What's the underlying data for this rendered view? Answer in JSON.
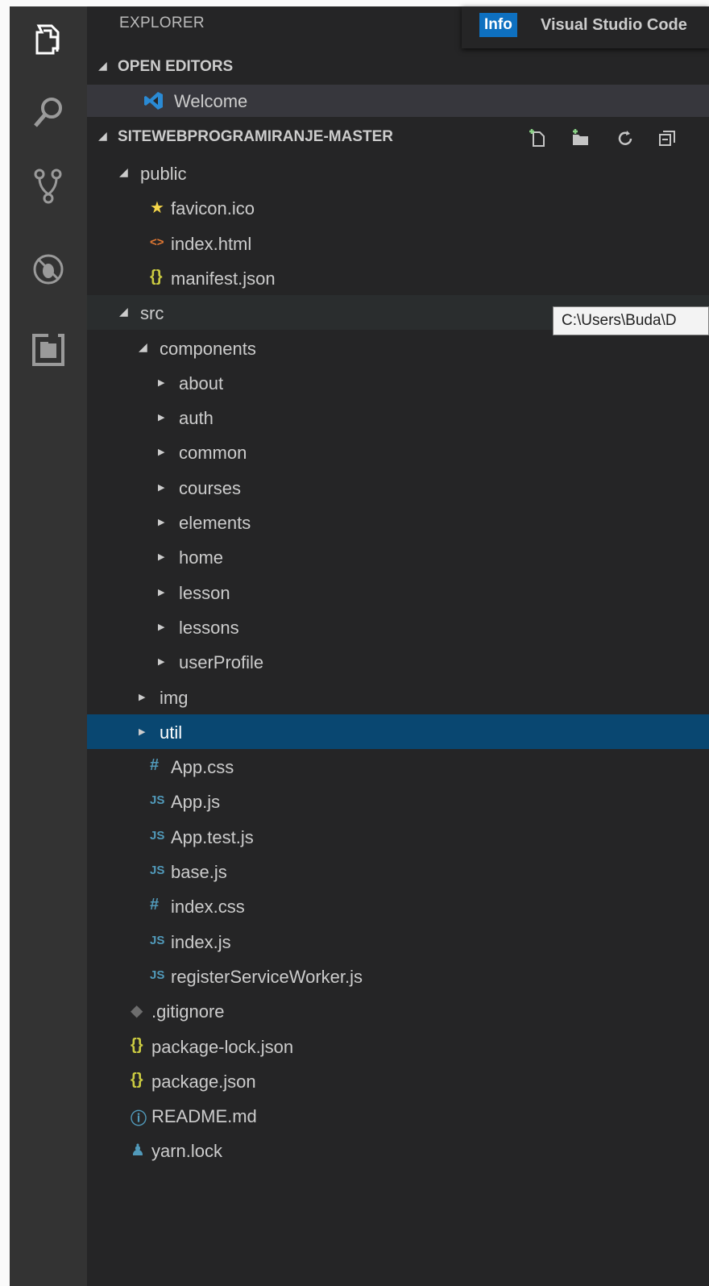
{
  "explorer": {
    "title": "EXPLORER",
    "open_editors": {
      "label": "OPEN EDITORS",
      "items": [
        {
          "label": "Welcome",
          "icon": "vscode-icon"
        }
      ]
    },
    "project": {
      "label": "SITEWEBPROGRAMIRANJE-MASTER",
      "actions": [
        "new-file-icon",
        "new-folder-icon",
        "refresh-icon",
        "collapse-all-icon"
      ]
    },
    "tree": [
      {
        "label": "public",
        "type": "folder",
        "expanded": true,
        "depth": 0
      },
      {
        "label": "favicon.ico",
        "type": "file",
        "icon": "star-icon",
        "depth": 1
      },
      {
        "label": "index.html",
        "type": "file",
        "icon": "html-icon",
        "depth": 1
      },
      {
        "label": "manifest.json",
        "type": "file",
        "icon": "json-icon",
        "depth": 1
      },
      {
        "label": "src",
        "type": "folder",
        "expanded": true,
        "depth": 0
      },
      {
        "label": "components",
        "type": "folder",
        "expanded": true,
        "depth": 1
      },
      {
        "label": "about",
        "type": "folder",
        "expanded": false,
        "depth": 2
      },
      {
        "label": "auth",
        "type": "folder",
        "expanded": false,
        "depth": 2
      },
      {
        "label": "common",
        "type": "folder",
        "expanded": false,
        "depth": 2
      },
      {
        "label": "courses",
        "type": "folder",
        "expanded": false,
        "depth": 2
      },
      {
        "label": "elements",
        "type": "folder",
        "expanded": false,
        "depth": 2
      },
      {
        "label": "home",
        "type": "folder",
        "expanded": false,
        "depth": 2
      },
      {
        "label": "lesson",
        "type": "folder",
        "expanded": false,
        "depth": 2
      },
      {
        "label": "lessons",
        "type": "folder",
        "expanded": false,
        "depth": 2
      },
      {
        "label": "userProfile",
        "type": "folder",
        "expanded": false,
        "depth": 2
      },
      {
        "label": "img",
        "type": "folder",
        "expanded": false,
        "depth": 1
      },
      {
        "label": "util",
        "type": "folder",
        "expanded": false,
        "depth": 1,
        "selected": true
      },
      {
        "label": "App.css",
        "type": "file",
        "icon": "css-icon",
        "depth": 1
      },
      {
        "label": "App.js",
        "type": "file",
        "icon": "js-icon",
        "depth": 1
      },
      {
        "label": "App.test.js",
        "type": "file",
        "icon": "js-icon",
        "depth": 1
      },
      {
        "label": "base.js",
        "type": "file",
        "icon": "js-icon",
        "depth": 1
      },
      {
        "label": "index.css",
        "type": "file",
        "icon": "css-icon",
        "depth": 1
      },
      {
        "label": "index.js",
        "type": "file",
        "icon": "js-icon",
        "depth": 1
      },
      {
        "label": "registerServiceWorker.js",
        "type": "file",
        "icon": "js-icon",
        "depth": 1
      },
      {
        "label": ".gitignore",
        "type": "file",
        "icon": "git-icon",
        "depth": 0
      },
      {
        "label": "package-lock.json",
        "type": "file",
        "icon": "json-icon",
        "depth": 0
      },
      {
        "label": "package.json",
        "type": "file",
        "icon": "json-icon",
        "depth": 0
      },
      {
        "label": "README.md",
        "type": "file",
        "icon": "info-icon",
        "depth": 0
      },
      {
        "label": "yarn.lock",
        "type": "file",
        "icon": "yarn-icon",
        "depth": 0
      }
    ]
  },
  "notification": {
    "badge": "Info",
    "message": "Visual Studio Code"
  },
  "tooltip": {
    "text": "C:\\Users\\Buda\\D"
  },
  "activity_bar": [
    "explorer-icon",
    "search-icon",
    "source-control-icon",
    "debug-icon",
    "extensions-icon"
  ],
  "colors": {
    "selected": "#094771",
    "json": "#cbcb41",
    "html": "#e37933",
    "js": "#519aba",
    "css": "#519aba",
    "star": "#f5d649",
    "info_badge": "#0e70c0"
  }
}
